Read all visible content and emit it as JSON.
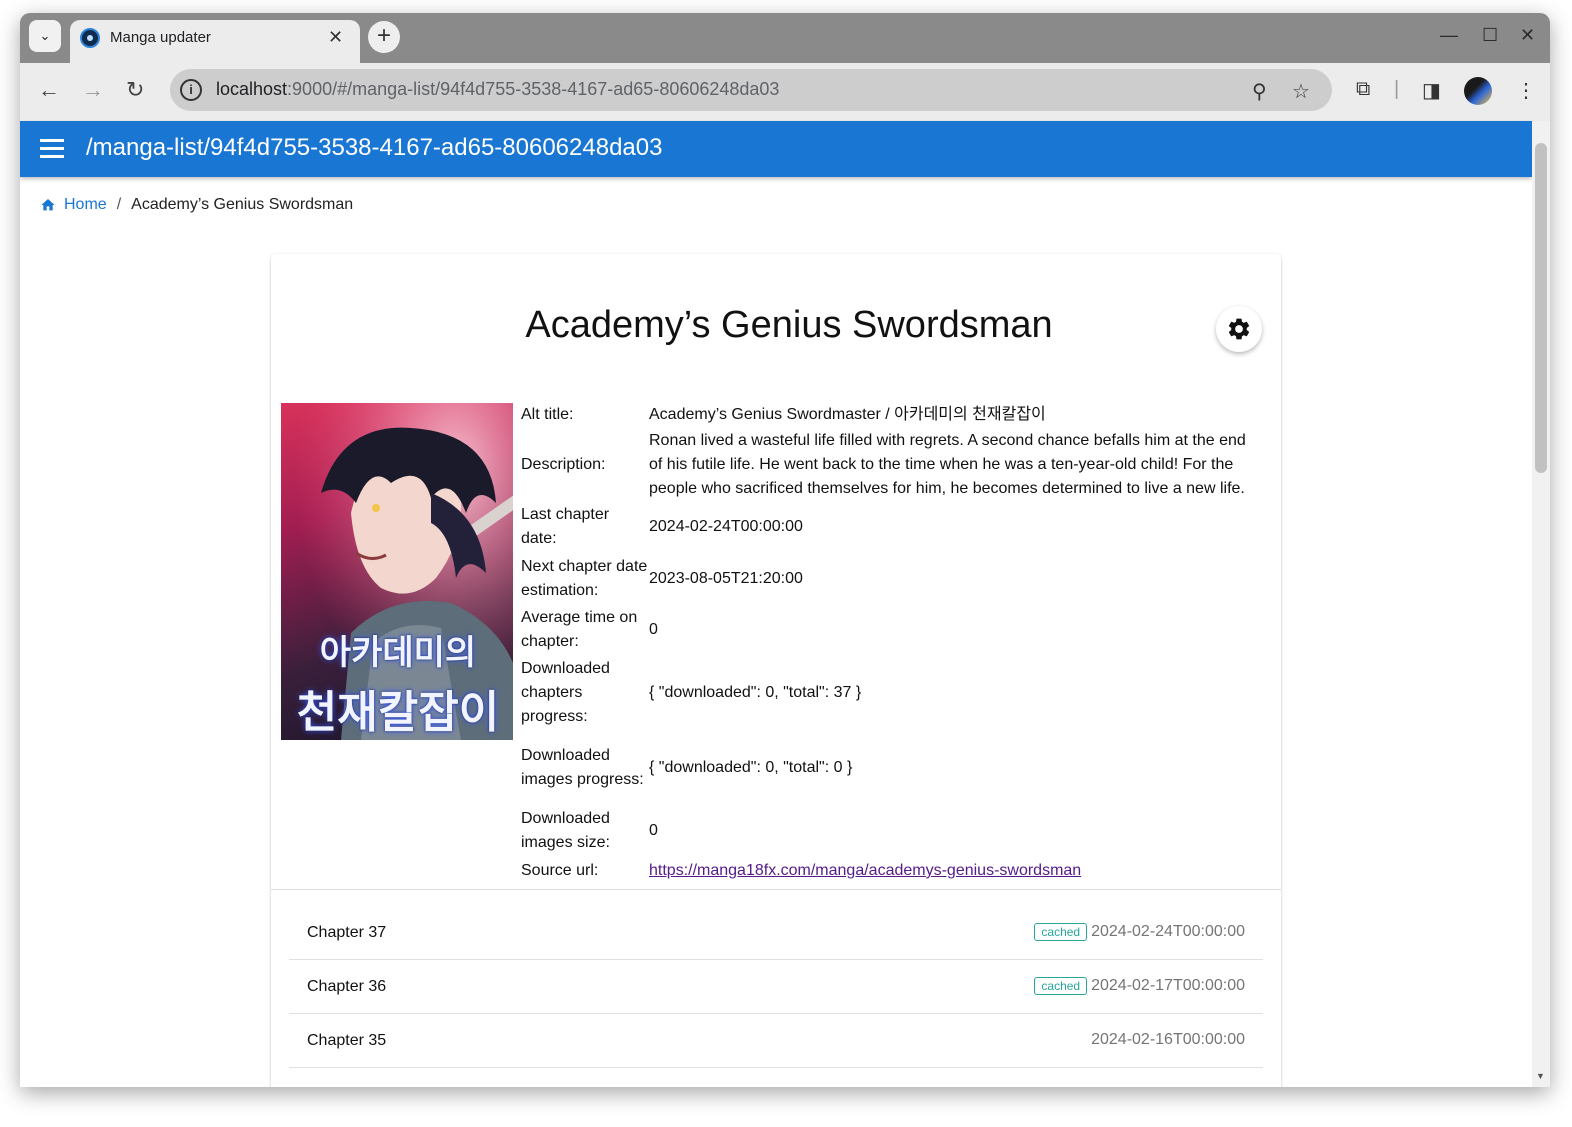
{
  "browser": {
    "tab_title": "Manga updater",
    "url_host": "localhost",
    "url_path": ":9000/#/manga-list/94f4d755-3538-4167-ad65-80606248da03"
  },
  "header": {
    "title": "/manga-list/94f4d755-3538-4167-ad65-80606248da03"
  },
  "breadcrumb": {
    "home": "Home",
    "separator": "/",
    "current": "Academy’s Genius Swordsman"
  },
  "manga": {
    "title": "Academy’s Genius Swordsman",
    "cover_text_line1": "아카데미의",
    "cover_text_line2": "천재칼잡이",
    "details": [
      {
        "label": "Alt title:",
        "value": "Academy’s Genius Swordmaster / 아카데미의 천재칼잡이"
      },
      {
        "label": "Description:",
        "value": "Ronan lived a wasteful life filled with regrets. A second chance befalls him at the end of his futile life. He went back to the time when he was a ten-year-old child! For the people who sacrificed themselves for him, he becomes determined to live a new life."
      },
      {
        "label": "Last chapter date:",
        "value": "2024-02-24T00:00:00"
      },
      {
        "label": "Next chapter date estimation:",
        "value": "2023-08-05T21:20:00"
      },
      {
        "label": "Average time on chapter:",
        "value": "0"
      },
      {
        "label": "Downloaded chapters progress:",
        "value": "{ \"downloaded\": 0, \"total\": 37 }"
      },
      {
        "label": "Downloaded images progress:",
        "value": "{ \"downloaded\": 0, \"total\": 0 }"
      },
      {
        "label": "Downloaded images size:",
        "value": "0"
      },
      {
        "label": "Source url:",
        "value": "https://manga18fx.com/manga/academys-genius-swordsman"
      }
    ]
  },
  "chapters": [
    {
      "name": "Chapter 37",
      "badge": "cached",
      "date": "2024-02-24T00:00:00"
    },
    {
      "name": "Chapter 36",
      "badge": "cached",
      "date": "2024-02-17T00:00:00"
    },
    {
      "name": "Chapter 35",
      "badge": "",
      "date": "2024-02-16T00:00:00"
    }
  ],
  "colors": {
    "app_bar": "#1976d2",
    "badge": "#26a69a",
    "link_visited": "#551a8b"
  }
}
